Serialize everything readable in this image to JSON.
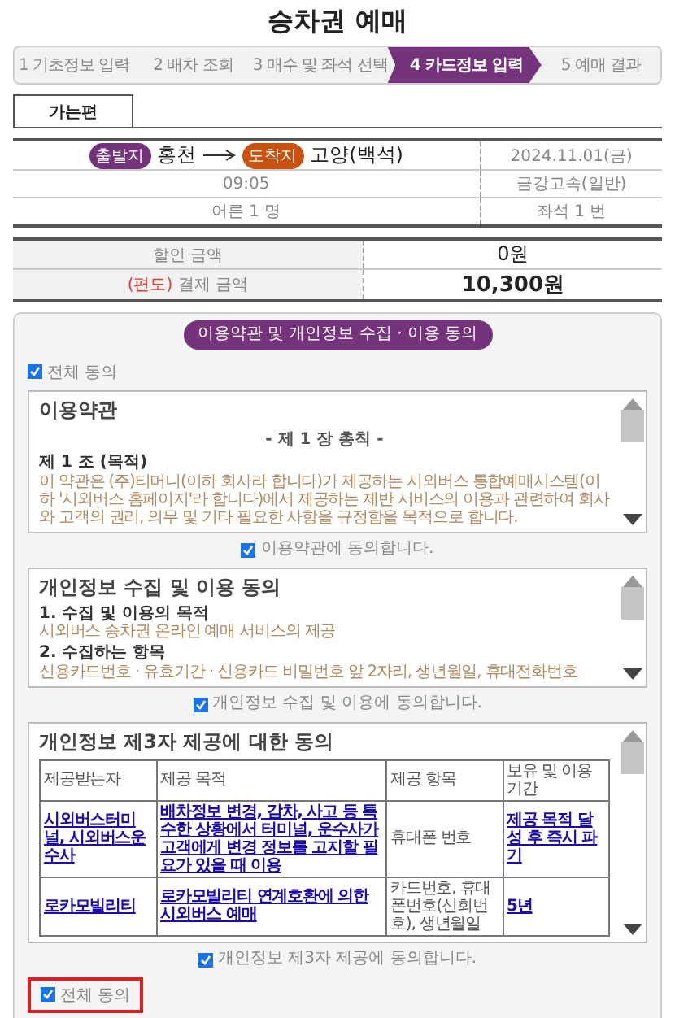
{
  "page_title": "승차권 예매",
  "steps": [
    {
      "label": "1 기초정보 입력",
      "selected": false
    },
    {
      "label": "2 배차 조회",
      "selected": false
    },
    {
      "label": "3 매수 및 좌석 선택",
      "selected": false
    },
    {
      "label": "4 카드정보 입력",
      "selected": true
    },
    {
      "label": "5 예매 결과",
      "selected": false
    }
  ],
  "tabs": [
    {
      "label": "가는편",
      "selected": true
    }
  ],
  "trip": {
    "departure_tag": "출발지",
    "departure": "홍천",
    "arrival_tag": "도착지",
    "arrival": "고양(백석)",
    "date": "2024.11.01(금)",
    "time": "09:05",
    "company": "금강고속(일반)",
    "passengers": "어른 1 명",
    "seat": "좌석 1 번"
  },
  "prices": [
    {
      "label": "할인 금액",
      "value": "0원"
    },
    {
      "note": "(편도)",
      "label": "결제 금액",
      "value": "10,300원"
    }
  ],
  "agreement": {
    "title": "이용약관 및 개인정보 수집 · 이용 동의",
    "select_all_top": {
      "label": "전체 동의",
      "checked": true
    },
    "sections": [
      {
        "kind": "text",
        "heading": "이용약관",
        "blocks": [
          {
            "kind": "chapter",
            "text": "- 제 1 장 총칙 -"
          },
          {
            "kind": "subheading",
            "text": "제 1 조 (목적)"
          },
          {
            "kind": "body",
            "text": "이 약관은 (주)티머니(이하 회사라 합니다)가 제공하는 시외버스 통합예매시스템(이하 '시외버스 홈페이지'라 합니다)에서 제공하는 제반 서비스의 이용과 관련하여 회사와 고객의 권리, 의무 및 기타 필요한 사항을 규정함을 목적으로 합니다."
          }
        ],
        "agree": {
          "label": "이용약관에 동의합니다.",
          "checked": true
        }
      },
      {
        "kind": "text",
        "heading": "개인정보 수집 및 이용 동의",
        "blocks": [
          {
            "kind": "subheading",
            "text": "1. 수집 및 이용의 목적"
          },
          {
            "kind": "body",
            "text": "시외버스 승차권 온라인 예매 서비스의 제공"
          },
          {
            "kind": "subheading",
            "text": "2. 수집하는 항목"
          },
          {
            "kind": "body",
            "text": "신용카드번호 · 유효기간 · 신용카드 비밀번호 앞 2자리, 생년월일, 휴대전화번호"
          }
        ],
        "agree": {
          "label": "개인정보 수집 및 이용에 동의합니다.",
          "checked": true
        }
      },
      {
        "kind": "table",
        "heading": "개인정보 제3자 제공에 대한 동의",
        "columns": [
          "제공받는자",
          "제공 목적",
          "제공 항목",
          "보유 및 이용기간"
        ],
        "rows": [
          [
            {
              "text": "시외버스터미널, 시외버스운수사",
              "link": true
            },
            {
              "text": "배차정보 변경, 감차, 사고 등 특수한 상황에서 터미널, 운수사가 고객에게 변경 정보를 고지할 필요가 있을 때 이용",
              "link": true
            },
            {
              "text": "휴대폰 번호",
              "link": false
            },
            {
              "text": "제공 목적 달성 후 즉시 파기",
              "link": true
            }
          ],
          [
            {
              "text": "로카모빌리티",
              "link": true
            },
            {
              "text": "로카모빌리티 연계호환에 의한 시외버스 예매",
              "link": true
            },
            {
              "text": "카드번호, 휴대폰번호(신회번호), 생년월일",
              "link": false
            },
            {
              "text": "5년",
              "link": true
            }
          ]
        ],
        "agree": {
          "label": "개인정보 제3자 제공에 동의합니다.",
          "checked": true
        }
      }
    ],
    "select_all_bottom": {
      "label": "전체 동의",
      "checked": true,
      "highlighted": true
    }
  }
}
